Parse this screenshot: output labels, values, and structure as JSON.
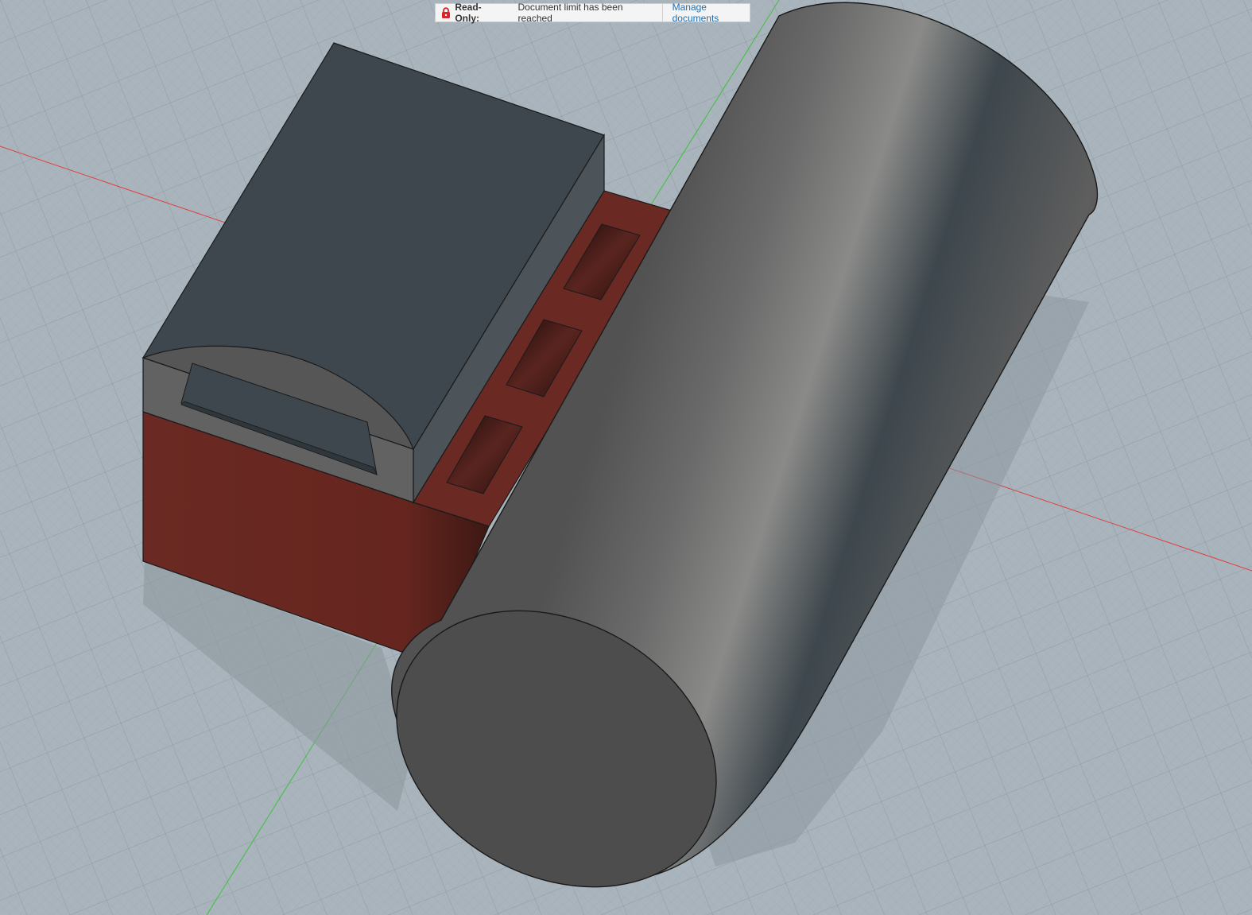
{
  "banner": {
    "icon": "lock-icon",
    "title": "Read-Only:",
    "message": "Document limit has been reached",
    "link_label": "Manage documents",
    "lock_color": "#d8232a",
    "link_color": "#1f6fb2"
  },
  "viewport": {
    "background_color": "#a9b4bc",
    "grid_color": "#9aa6ae",
    "x_axis_color": "#e04040",
    "y_axis_color": "#3fbf3f",
    "base_body_color": "#6b2a24",
    "box_color": "#3d474d",
    "cylinder_color": "#4a4a4a"
  }
}
